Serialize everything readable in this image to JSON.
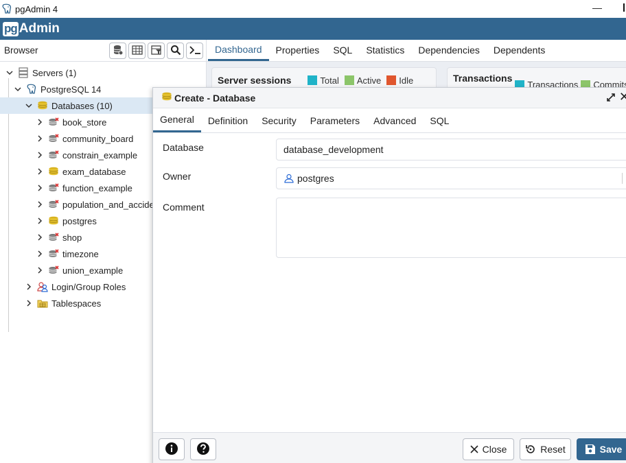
{
  "window": {
    "title": "pgAdmin 4",
    "minimize": "—"
  },
  "brand": {
    "pg": "pg",
    "admin": "Admin"
  },
  "browser": {
    "label": "Browser",
    "toolbar": [
      "database-icon",
      "table-icon",
      "filter-rows-icon",
      "search-icon",
      "terminal-icon"
    ],
    "tree": [
      {
        "label": "Servers (1)",
        "icon": "servers-icon",
        "level": 0,
        "expanded": true
      },
      {
        "label": "PostgreSQL 14",
        "icon": "elephant-icon",
        "level": 1,
        "expanded": true
      },
      {
        "label": "Databases (10)",
        "icon": "database-icon",
        "level": 2,
        "expanded": true,
        "selected": true
      },
      {
        "label": "book_store",
        "icon": "database-disconnected-icon",
        "level": 3
      },
      {
        "label": "community_board",
        "icon": "database-disconnected-icon",
        "level": 3
      },
      {
        "label": "constrain_example",
        "icon": "database-disconnected-icon",
        "level": 3
      },
      {
        "label": "exam_database",
        "icon": "database-icon",
        "level": 3
      },
      {
        "label": "function_example",
        "icon": "database-disconnected-icon",
        "level": 3
      },
      {
        "label": "population_and_accide",
        "icon": "database-disconnected-icon",
        "level": 3
      },
      {
        "label": "postgres",
        "icon": "database-icon",
        "level": 3
      },
      {
        "label": "shop",
        "icon": "database-disconnected-icon",
        "level": 3
      },
      {
        "label": "timezone",
        "icon": "database-disconnected-icon",
        "level": 3
      },
      {
        "label": "union_example",
        "icon": "database-disconnected-icon",
        "level": 3
      },
      {
        "label": "Login/Group Roles",
        "icon": "roles-icon",
        "level": 2
      },
      {
        "label": "Tablespaces",
        "icon": "tablespaces-icon",
        "level": 2
      }
    ]
  },
  "main_tabs": [
    "Dashboard",
    "Properties",
    "SQL",
    "Statistics",
    "Dependencies",
    "Dependents"
  ],
  "dashboard": {
    "server_sessions": {
      "title": "Server sessions",
      "legend": [
        "Total",
        "Active",
        "Idle"
      ]
    },
    "transactions": {
      "title": "Transactions",
      "legend": [
        "Transactions",
        "Commits"
      ]
    }
  },
  "dialog": {
    "title": "Create - Database",
    "tabs": [
      "General",
      "Definition",
      "Security",
      "Parameters",
      "Advanced",
      "SQL"
    ],
    "fields": {
      "database_label": "Database",
      "database_value": "database_development",
      "owner_label": "Owner",
      "owner_value": "postgres",
      "comment_label": "Comment",
      "comment_value": ""
    },
    "footer": {
      "close": "Close",
      "reset": "Reset",
      "save": "Save"
    }
  },
  "colors": {
    "brand": "#326690",
    "total": "#20b3c8",
    "active": "#8cc56a",
    "idle": "#e0562e",
    "selected_row": "#dbe8f4"
  }
}
